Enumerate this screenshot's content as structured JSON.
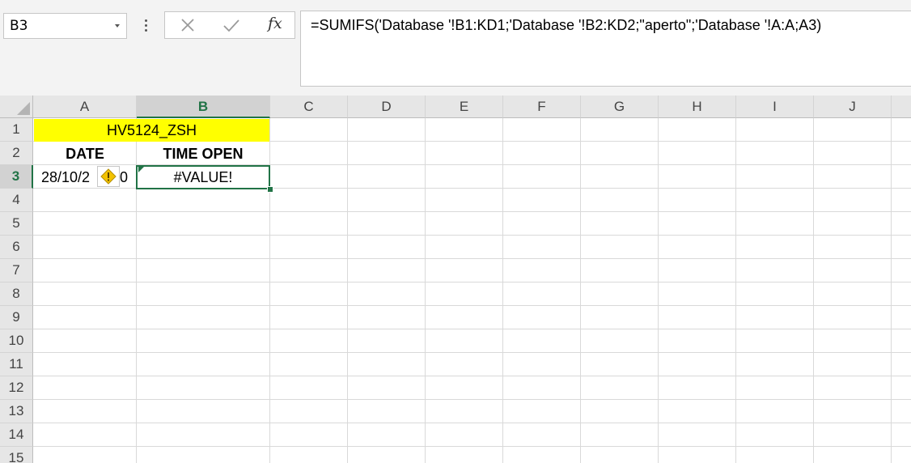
{
  "name_box": {
    "value": "B3"
  },
  "formula_bar": {
    "fx_label": "fx",
    "formula": "=SUMIFS('Database '!B1:KD1;'Database '!B2:KD2;\"aperto\";'Database '!A:A;A3)"
  },
  "columns": [
    "A",
    "B",
    "C",
    "D",
    "E",
    "F",
    "G",
    "H",
    "I",
    "J"
  ],
  "rows": [
    "1",
    "2",
    "3",
    "4",
    "5",
    "6",
    "7",
    "8",
    "9",
    "10",
    "11",
    "12",
    "13",
    "14",
    "15"
  ],
  "selected": {
    "column": "B",
    "row": "3"
  },
  "cells": {
    "title": "HV5124_ZSH",
    "header_a": "DATE",
    "header_b": "TIME OPEN",
    "a3": "28/10/2",
    "a3_tail": "0",
    "b3": "#VALUE!"
  },
  "colors": {
    "accent": "#217346",
    "title_fill": "#ffff00",
    "warning": "#f2c200"
  },
  "icons": {
    "cancel": "cancel-icon",
    "enter": "check-icon",
    "warning": "warning-icon"
  }
}
